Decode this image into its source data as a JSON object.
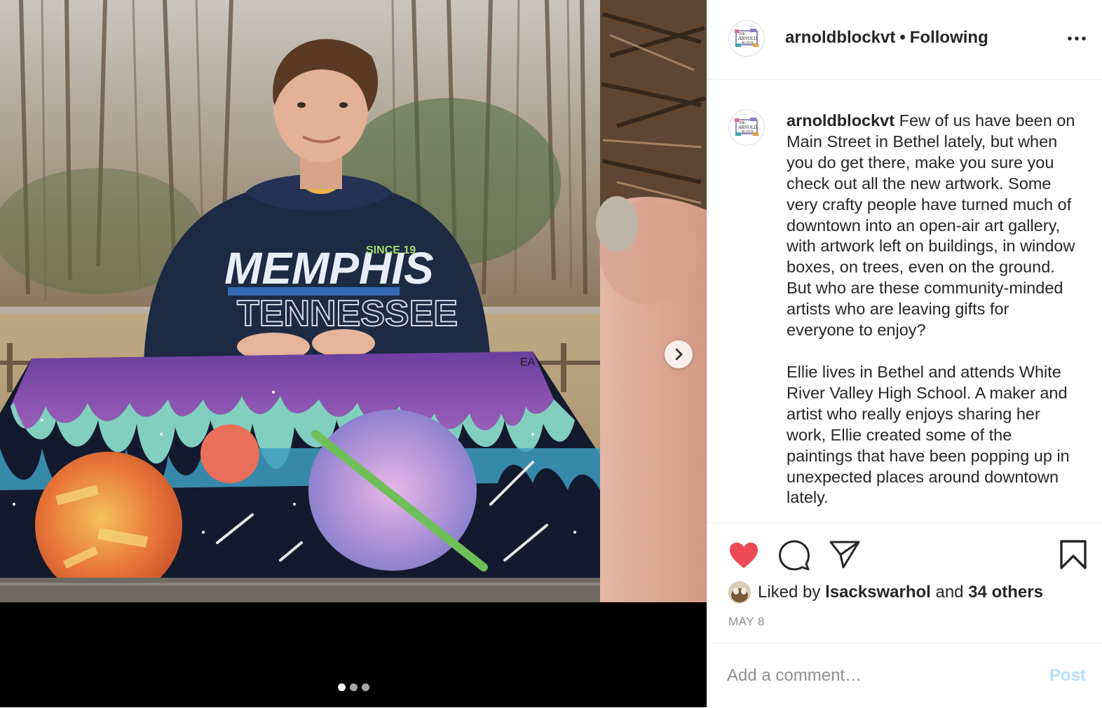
{
  "post": {
    "username": "arnoldblockvt",
    "follow_status": "Following",
    "separator": "•",
    "avatar_lines": [
      "THE",
      "ARNOLD",
      "BLOCK"
    ],
    "caption_paragraphs": [
      "Few of us have been on Main Street in Bethel lately, but when you do get there, make you sure you check out all the new artwork. Some very crafty people have turned much of downtown into an open-air art gallery, with artwork left on buildings, in window boxes, on trees, even on the ground. But who are these community-minded artists who are leaving gifts for everyone to enjoy?",
      "Ellie lives in Bethel and attends White River Valley High School. A maker and artist who really enjoys sharing her work, Ellie created some of the paintings that have been popping up in unexpected places around downtown lately."
    ],
    "likes": {
      "prefix": "Liked by",
      "user": "lsackswarhol",
      "conjunction": "and",
      "others": "34 others"
    },
    "date": "MAY 8",
    "comment": {
      "placeholder": "Add a comment…",
      "post_label": "Post"
    }
  },
  "media": {
    "slide_count": 3,
    "active_slide": 1,
    "hoodie_lines": [
      "MEMPHIS",
      "TENNESSEE",
      "SINCE 19"
    ],
    "artwork_initials": "EA"
  },
  "icons": {
    "like": "heart-filled-icon",
    "comment": "comment-bubble-icon",
    "share": "paper-plane-icon",
    "save": "bookmark-icon",
    "more": "more-options-icon",
    "next": "chevron-right-icon"
  },
  "colors": {
    "like_red": "#ed4956",
    "post_disabled": "#b2dffc",
    "secondary_text": "#8e8e8e",
    "primary_text": "#262626"
  }
}
